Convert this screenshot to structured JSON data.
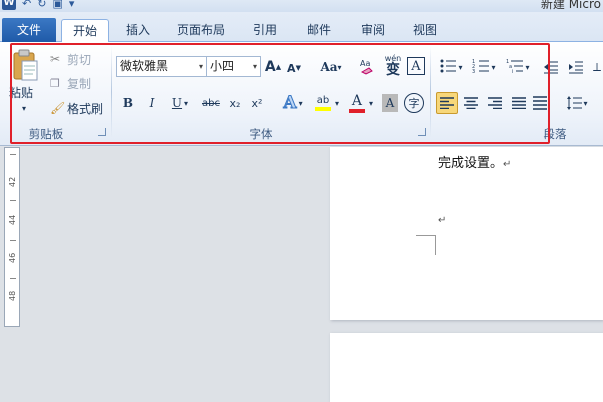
{
  "window": {
    "title": "新建 Micro"
  },
  "tabs": {
    "file": "文件",
    "items": [
      "开始",
      "插入",
      "页面布局",
      "引用",
      "邮件",
      "审阅",
      "视图"
    ]
  },
  "clipboard": {
    "paste": "粘贴",
    "cut": "剪切",
    "copy": "复制",
    "format_painter": "格式刷",
    "group_label": "剪贴板"
  },
  "font": {
    "font_name": "微软雅黑",
    "font_size": "小四",
    "change_case": "Aa",
    "group_label": "字体",
    "bold": "B",
    "italic": "I",
    "underline": "U",
    "strikethrough": "abc",
    "subscript": "x₂",
    "superscript": "x²",
    "text_effects": "A",
    "highlight": "ab",
    "font_color": "A",
    "char_shading": "A",
    "enclose_char": "字",
    "phonetic": "wén",
    "phonetic_char": "变",
    "border_char": "A",
    "grow": "A",
    "shrink": "A"
  },
  "paragraph": {
    "group_label": "段落"
  },
  "document": {
    "line1": "完成设置。",
    "paragraph_mark": "↵",
    "ruler_ticks": [
      "42",
      "44",
      "46",
      "48"
    ]
  },
  "colors": {
    "accent": "#2b5797",
    "highlight_yellow": "#ffff00",
    "font_red": "#e0202a",
    "selection": "#f7d77a"
  }
}
